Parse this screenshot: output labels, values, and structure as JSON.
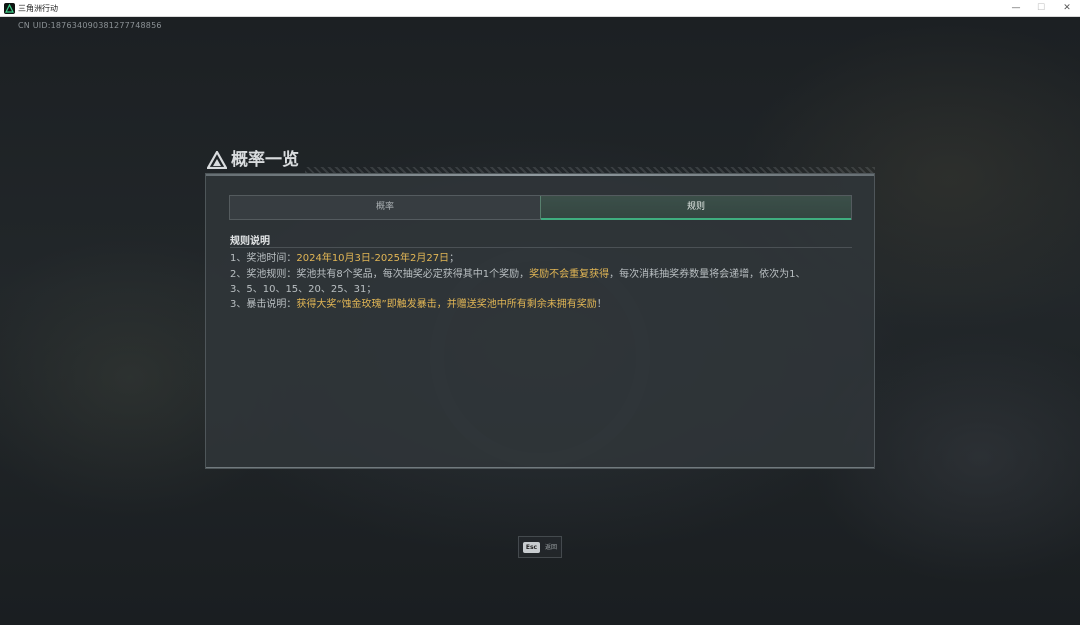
{
  "window": {
    "title": "三角洲行动",
    "controls": [
      "—",
      "☐",
      "✕"
    ]
  },
  "game": {
    "uid": "CN UID:187634090381277748856"
  },
  "panel": {
    "title": "概率一览",
    "tabs": [
      {
        "label": "概率",
        "active": false
      },
      {
        "label": "规则",
        "active": true
      }
    ],
    "section_title": "规则说明",
    "rules": {
      "line1": {
        "prefix": "1、奖池时间：",
        "highlight": "2024年10月3日-2025年2月27日",
        "suffix": "；"
      },
      "line2": {
        "prefix": "2、奖池规则：奖池共有8个奖品，每次抽奖必定获得其中1个奖励，",
        "highlight": "奖励不会重复获得",
        "suffix": "，每次消耗抽奖券数量将会递增，依次为1、"
      },
      "line2b": {
        "text": "3、5、10、15、20、25、31；"
      },
      "line3": {
        "prefix": "3、暴击说明：",
        "highlight": "获得大奖“蚀金玫瑰”即触发暴击，并赠送奖池中所有剩余未拥有奖励",
        "suffix": "！"
      }
    }
  },
  "footer": {
    "esc_key": "Esc",
    "esc_label": "返回"
  },
  "colors": {
    "accent_green": "#3fae7f",
    "highlight_gold": "#e2b655"
  }
}
